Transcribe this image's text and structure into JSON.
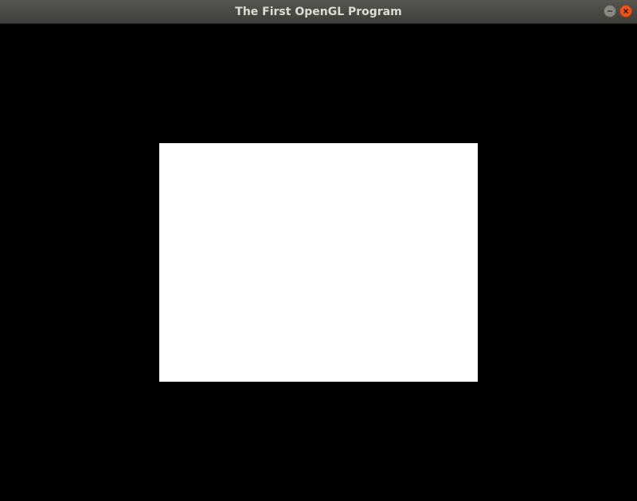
{
  "window": {
    "title": "The First OpenGL Program",
    "controls": {
      "minimize_icon": "minimize-icon",
      "close_icon": "close-icon"
    }
  },
  "canvas": {
    "background_color": "#000000",
    "rectangle_color": "#ffffff"
  },
  "colors": {
    "titlebar": "#4a4944",
    "title_text": "#dfdbd2",
    "close_button": "#e9541f",
    "minimize_button": "#8a887f"
  }
}
